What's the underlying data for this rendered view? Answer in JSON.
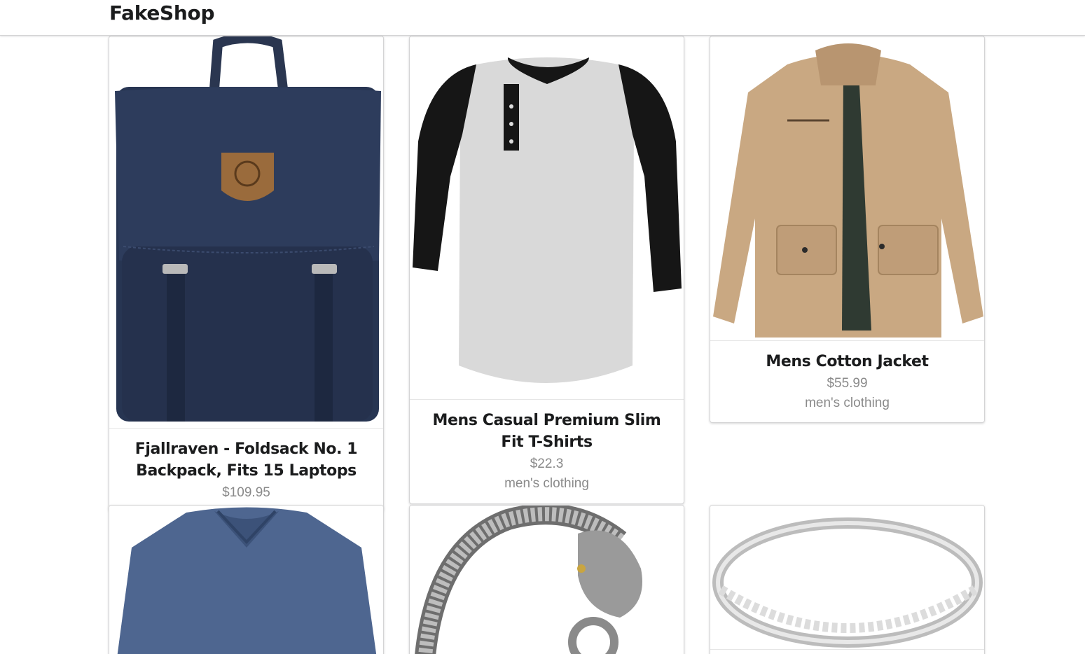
{
  "app": {
    "brand": "FakeShop"
  },
  "products": [
    {
      "title": "Fjallraven - Foldsack No. 1 Backpack, Fits 15 Laptops",
      "price": "$109.95",
      "category": ""
    },
    {
      "title": "Mens Casual Premium Slim Fit T-Shirts",
      "price": "$22.3",
      "category": "men's clothing"
    },
    {
      "title": "Mens Cotton Jacket",
      "price": "$55.99",
      "category": "men's clothing"
    },
    {
      "title": "",
      "price": "",
      "category": ""
    },
    {
      "title": "",
      "price": "",
      "category": ""
    },
    {
      "title": "",
      "price": "",
      "category": ""
    }
  ],
  "images": [
    "backpack",
    "raglan-tshirt",
    "cotton-jacket",
    "vneck-shirt",
    "dragon-bracelet",
    "diamond-ring"
  ],
  "colors": {
    "text": "#1b1c1d",
    "meta": "#8a8a8a",
    "border": "#d4d4d5"
  }
}
